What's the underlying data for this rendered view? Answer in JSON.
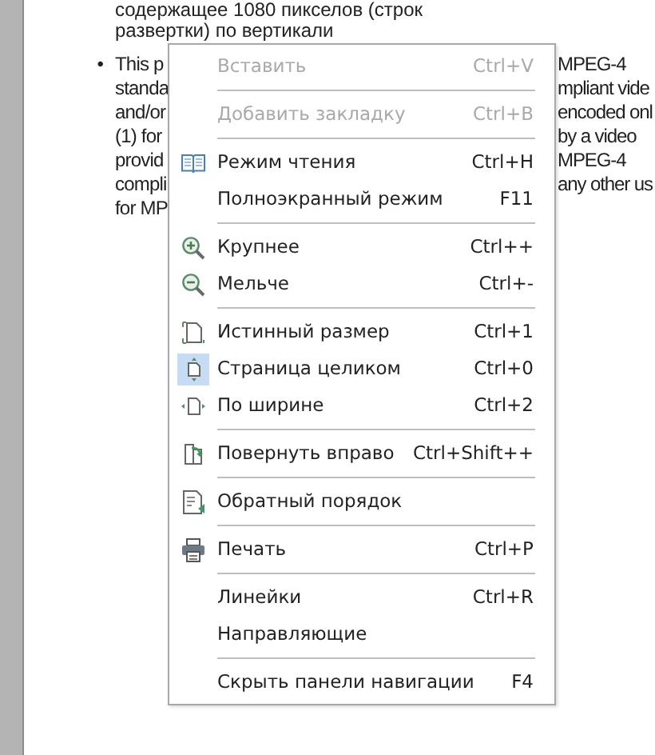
{
  "document": {
    "lines": [
      "содержащее 1080 пикселов (строк",
      "развертки) по вертикали"
    ],
    "bullet": "•",
    "left_fragments": [
      "This p",
      "standa",
      "and/or",
      "(1) for",
      "provid",
      "compli",
      "for MP"
    ],
    "right_fragments": [
      "MPEG-4",
      "mpliant vide",
      "encoded onl",
      "by a video",
      "MPEG-4",
      "any other us"
    ]
  },
  "context_menu": {
    "items": [
      {
        "kind": "item",
        "label": "Вставить",
        "shortcut": "Ctrl+V",
        "disabled": true,
        "checked": false
      },
      {
        "kind": "separator"
      },
      {
        "kind": "item",
        "label": "Добавить закладку",
        "shortcut": "Ctrl+B",
        "disabled": true,
        "checked": false
      },
      {
        "kind": "separator"
      },
      {
        "kind": "item",
        "label": "Режим чтения",
        "shortcut": "Ctrl+H",
        "disabled": false,
        "checked": false
      },
      {
        "kind": "item",
        "label": "Полноэкранный режим",
        "shortcut": "F11",
        "disabled": false,
        "checked": false
      },
      {
        "kind": "separator"
      },
      {
        "kind": "item",
        "label": "Крупнее",
        "shortcut": "Ctrl++",
        "disabled": false,
        "checked": false
      },
      {
        "kind": "item",
        "label": "Мельче",
        "shortcut": "Ctrl+-",
        "disabled": false,
        "checked": false
      },
      {
        "kind": "separator"
      },
      {
        "kind": "item",
        "label": "Истинный размер",
        "shortcut": "Ctrl+1",
        "disabled": false,
        "checked": false
      },
      {
        "kind": "item",
        "label": "Страница целиком",
        "shortcut": "Ctrl+0",
        "disabled": false,
        "checked": true
      },
      {
        "kind": "item",
        "label": "По ширине",
        "shortcut": "Ctrl+2",
        "disabled": false,
        "checked": false
      },
      {
        "kind": "separator"
      },
      {
        "kind": "item",
        "label": "Повернуть вправо",
        "shortcut": "Ctrl+Shift++",
        "disabled": false,
        "checked": false
      },
      {
        "kind": "separator"
      },
      {
        "kind": "item",
        "label": "Обратный порядок",
        "disabled": false,
        "checked": false
      },
      {
        "kind": "separator"
      },
      {
        "kind": "item",
        "label": "Печать",
        "shortcut": "Ctrl+P",
        "disabled": false,
        "checked": false
      },
      {
        "kind": "separator"
      },
      {
        "kind": "item",
        "label": "Линейки",
        "shortcut": "Ctrl+R",
        "disabled": false,
        "checked": false
      },
      {
        "kind": "item",
        "label": "Направляющие",
        "disabled": false,
        "checked": false
      },
      {
        "kind": "separator"
      },
      {
        "kind": "item",
        "label": "Скрыть панели навигации",
        "shortcut": "F4",
        "disabled": false,
        "checked": false
      }
    ]
  }
}
